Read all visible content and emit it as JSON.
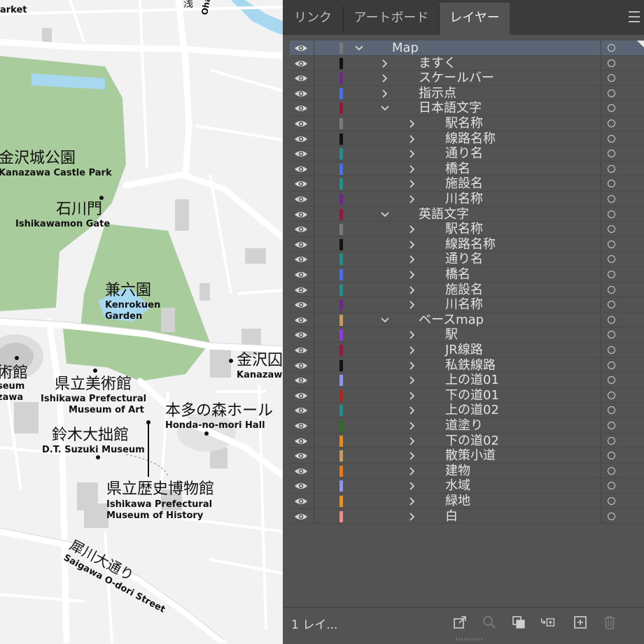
{
  "map": {
    "labels": {
      "market": "arket",
      "ohashi": "Ohas",
      "kanazawa_castle_jp": "金沢城公園",
      "kanazawa_castle_en": "Kanazawa Castle Park",
      "ishikawamon_jp": "石川門",
      "ishikawamon_en": "Ishikawamon Gate",
      "kenrokuen_jp": "兼六園",
      "kenrokuen_en1": "Kenrokuen",
      "kenrokuen_en2": "Garden",
      "museum_left_jp": "術館",
      "museum_left_en1": "seum",
      "museum_left_en2": "zawa",
      "kanazawa_right_jp": "金沢囚",
      "kanazawa_right_en": "Kanazaw",
      "art_jp": "県立美術館",
      "art_en1": "Ishikawa Prefectural",
      "art_en2": "Museum of Art",
      "honda_jp": "本多の森ホール",
      "honda_en": "Honda-no-mori Hall",
      "suzuki_jp": "鈴木大拙館",
      "suzuki_en": "D.T. Suzuki Museum",
      "history_jp": "県立歴史博物館",
      "history_en1": "Ishikawa Prefectural",
      "history_en2": "Museum of History",
      "saigawa_jp": "犀川大通り",
      "saigawa_en": "Saigawa O-dori Street",
      "top_jp": "浅"
    },
    "colors": {
      "park": "#a9cc9c",
      "water": "#a8d8f0",
      "road": "#ffffff",
      "block": "#f1f1f1",
      "building": "#cfcfcf"
    }
  },
  "panel": {
    "tabs": [
      {
        "label": "リンク",
        "active": false
      },
      {
        "label": "アートボード",
        "active": false
      },
      {
        "label": "レイヤー",
        "active": true
      }
    ],
    "footer_label": "1 レイ...",
    "layers": [
      {
        "name": "Map",
        "depth": 0,
        "expanded": true,
        "color": "#7a7a7a",
        "selected": true
      },
      {
        "name": "ますく",
        "depth": 1,
        "expanded": false,
        "color": "#111111"
      },
      {
        "name": "スケールバー",
        "depth": 1,
        "expanded": false,
        "color": "#6a2a82"
      },
      {
        "name": "指示点",
        "depth": 1,
        "expanded": false,
        "color": "#4d6fe0"
      },
      {
        "name": "日本語文字",
        "depth": 1,
        "expanded": true,
        "color": "#8b1d3a"
      },
      {
        "name": "駅名称",
        "depth": 2,
        "expanded": false,
        "color": "#7a7a7a"
      },
      {
        "name": "線路名称",
        "depth": 2,
        "expanded": false,
        "color": "#111111"
      },
      {
        "name": "通り名",
        "depth": 2,
        "expanded": false,
        "color": "#2e8a86"
      },
      {
        "name": "橋名",
        "depth": 2,
        "expanded": false,
        "color": "#4d6fe0"
      },
      {
        "name": "施設名",
        "depth": 2,
        "expanded": false,
        "color": "#2e8a86"
      },
      {
        "name": "川名称",
        "depth": 2,
        "expanded": false,
        "color": "#6a2a82"
      },
      {
        "name": "英語文字",
        "depth": 1,
        "expanded": true,
        "color": "#8b1d3a"
      },
      {
        "name": "駅名称",
        "depth": 2,
        "expanded": false,
        "color": "#7a7a7a"
      },
      {
        "name": "線路名称",
        "depth": 2,
        "expanded": false,
        "color": "#111111"
      },
      {
        "name": "通り名",
        "depth": 2,
        "expanded": false,
        "color": "#2e8a86"
      },
      {
        "name": "橋名",
        "depth": 2,
        "expanded": false,
        "color": "#4d6fe0"
      },
      {
        "name": "施設名",
        "depth": 2,
        "expanded": false,
        "color": "#2e8a86"
      },
      {
        "name": "川名称",
        "depth": 2,
        "expanded": false,
        "color": "#6a2a82"
      },
      {
        "name": "ベースmap",
        "depth": 1,
        "expanded": true,
        "color": "#c79a64"
      },
      {
        "name": "駅",
        "depth": 2,
        "expanded": false,
        "color": "#8a3fd6"
      },
      {
        "name": "JR線路",
        "depth": 2,
        "expanded": false,
        "color": "#8b1d3a"
      },
      {
        "name": "私鉄線路",
        "depth": 2,
        "expanded": false,
        "color": "#111111"
      },
      {
        "name": "上の道01",
        "depth": 2,
        "expanded": false,
        "color": "#8f95e8"
      },
      {
        "name": "下の道01",
        "depth": 2,
        "expanded": false,
        "color": "#a32a2a"
      },
      {
        "name": "上の道02",
        "depth": 2,
        "expanded": false,
        "color": "#2e8a86"
      },
      {
        "name": "道塗り",
        "depth": 2,
        "expanded": false,
        "color": "#2f6a2a"
      },
      {
        "name": "下の道02",
        "depth": 2,
        "expanded": false,
        "color": "#e08a2a"
      },
      {
        "name": "散策小道",
        "depth": 2,
        "expanded": false,
        "color": "#c79a64"
      },
      {
        "name": "建物",
        "depth": 2,
        "expanded": false,
        "color": "#e07a2a"
      },
      {
        "name": "水域",
        "depth": 2,
        "expanded": false,
        "color": "#8f95e8"
      },
      {
        "name": "緑地",
        "depth": 2,
        "expanded": false,
        "color": "#e0962a"
      },
      {
        "name": "白",
        "depth": 2,
        "expanded": false,
        "color": "#e89090"
      }
    ]
  }
}
